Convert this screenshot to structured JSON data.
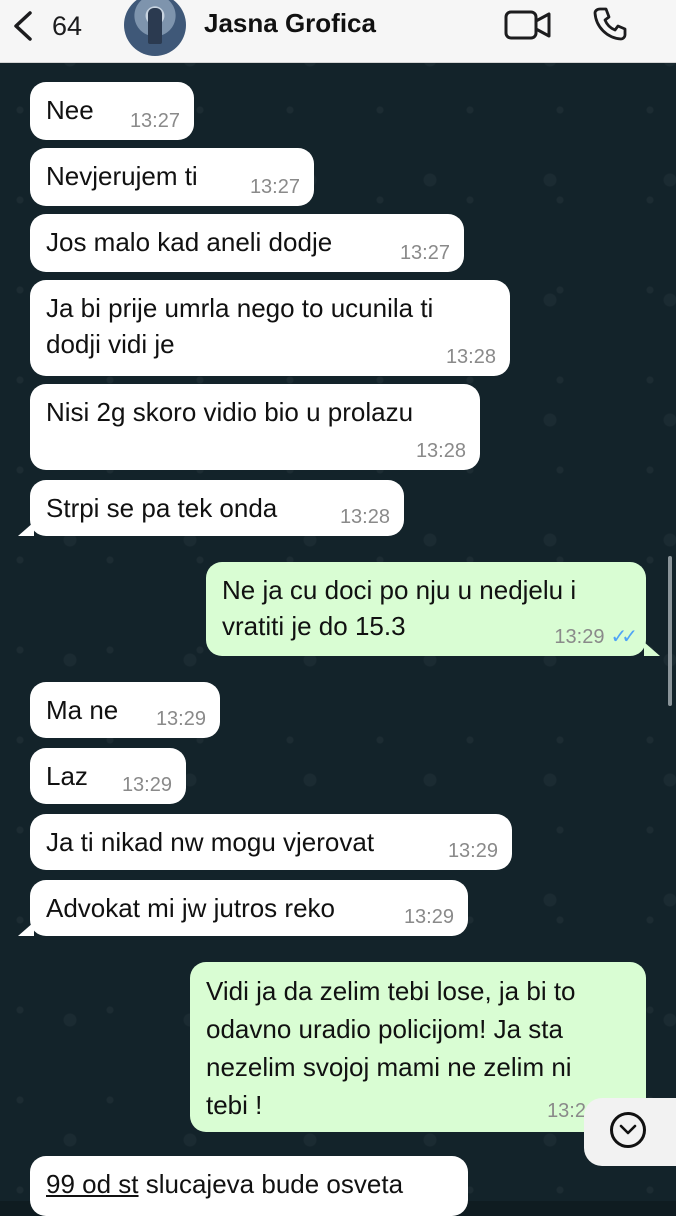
{
  "header": {
    "back_count": "64",
    "contact_name": "Jasna Grofica"
  },
  "messages": [
    {
      "text": "Nee",
      "time": "13:27",
      "direction": "in"
    },
    {
      "text": "Nevjerujem ti",
      "time": "13:27",
      "direction": "in"
    },
    {
      "text": "Jos malo kad aneli dodje",
      "time": "13:27",
      "direction": "in"
    },
    {
      "text_line1": "Ja bi prije umrla nego to ucunila ti",
      "text_line2": "dodji vidi je",
      "time": "13:28",
      "direction": "in"
    },
    {
      "text": "Nisi 2g skoro vidio bio u prolazu",
      "time": "13:28",
      "direction": "in"
    },
    {
      "text": "Strpi se pa tek onda",
      "time": "13:28",
      "direction": "in"
    },
    {
      "text_line1": "Ne ja cu doci po nju u nedjelu i",
      "text_line2": "vratiti je do 15.3",
      "time": "13:29",
      "direction": "out",
      "status": "read"
    },
    {
      "text": "Ma ne",
      "time": "13:29",
      "direction": "in"
    },
    {
      "text": "Laz",
      "time": "13:29",
      "direction": "in"
    },
    {
      "text": "Ja ti nikad nw mogu vjerovat",
      "time": "13:29",
      "direction": "in"
    },
    {
      "text": "Advokat mi jw jutros reko",
      "time": "13:29",
      "direction": "in"
    },
    {
      "text_line1": "Vidi ja da zelim tebi lose, ja bi to",
      "text_line2": "odavno uradio policijom! Ja sta",
      "text_line3": "nezelim svojoj mami ne zelim ni",
      "text_line4": "tebi !",
      "time": "13:2",
      "direction": "out"
    },
    {
      "text_prefix": "99 od st",
      "text_rest": " slucajeva bude osveta",
      "direction": "in"
    }
  ],
  "colors": {
    "incoming_bubble": "#ffffff",
    "outgoing_bubble": "#d9fdd3",
    "read_ticks": "#4fa3f5",
    "chat_background": "#13232a"
  },
  "icons": [
    "chevron-left-icon",
    "video-call-icon",
    "phone-icon",
    "double-check-icon",
    "scroll-down-icon"
  ]
}
